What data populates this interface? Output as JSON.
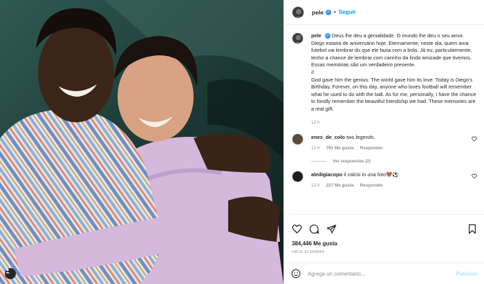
{
  "post": {
    "photo_alt": "",
    "author": "pele",
    "follow_label": "Seguir",
    "dot": "•",
    "verified_glyph": "✓"
  },
  "caption": {
    "username": "pele",
    "pt": "Deus lhe deu a genialidade. O mundo lhe deu o seu amor. Diego estaria de aniversário hoje. Eternamente, neste dia, quem ama futebol vai lembrar do que ele fazia com a bola. Já eu, particularmente, tenho a chance de lembrar com carinho da linda amizade que tivemos. Essas memórias são um verdadeiro presente.",
    "divider": "//",
    "en": "God gave him the genius. The world gave him its love. Today is Diego's Birthday. Forever, on this day, anyone who loves football will remember what he used to do with the ball. As for me, personally, I have the chance to fondly remember the beautiful friendship we had. These memories are a real gift.",
    "time": "12 h"
  },
  "comments": [
    {
      "username": "enes_de_colo",
      "text": "two legends.",
      "time": "12 h",
      "likes": "791 Me gusta",
      "reply": "Responder",
      "view_replies": "Ver respuestas (2)"
    },
    {
      "username": "aledigiacopo",
      "text": "il calcio in una foto🤎⚽",
      "time": "12 h",
      "likes": "227 Me gusta",
      "reply": "Responder"
    }
  ],
  "actions": {
    "likes": "384,446 Me gusta",
    "timestamp": "HACE 12 HORAS"
  },
  "add_comment": {
    "placeholder": "Agrega un comentario...",
    "publish": "Publicar"
  },
  "colors": {
    "link_blue": "#0095f6",
    "publish_disabled": "#b2dffc",
    "muted": "#8e8e8e"
  },
  "icons": [
    "heart-icon",
    "comment-icon",
    "share-icon",
    "bookmark-icon",
    "emoji-icon",
    "verified-icon",
    "tag-user-icon"
  ]
}
